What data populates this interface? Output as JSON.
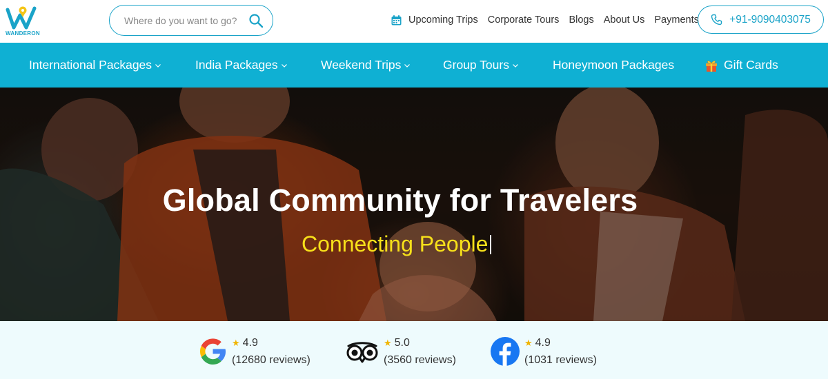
{
  "brand": {
    "name": "WANDERON",
    "accent": "#0fb0d3"
  },
  "search": {
    "placeholder": "Where do you want to go?",
    "icon": "search-icon"
  },
  "top_links": [
    {
      "label": "Upcoming Trips",
      "icon": "calendar-icon"
    },
    {
      "label": "Corporate Tours"
    },
    {
      "label": "Blogs"
    },
    {
      "label": "About Us"
    },
    {
      "label": "Payments"
    }
  ],
  "phone": {
    "label": "+91-9090403075",
    "icon": "phone-icon"
  },
  "nav": [
    {
      "label": "International Packages",
      "dropdown": true
    },
    {
      "label": "India Packages",
      "dropdown": true
    },
    {
      "label": "Weekend Trips",
      "dropdown": true
    },
    {
      "label": "Group Tours",
      "dropdown": true
    },
    {
      "label": "Honeymoon Packages",
      "dropdown": false
    },
    {
      "label": "Gift Cards",
      "icon": "gift-icon"
    }
  ],
  "hero": {
    "title": "Global Community for Travelers",
    "subtitle": "Connecting People",
    "subtitle_color": "#f7e01a"
  },
  "reviews": [
    {
      "platform_icon": "google-icon",
      "rating": "4.9",
      "count": "(12680 reviews)"
    },
    {
      "platform_icon": "tripadvisor-icon",
      "rating": "5.0",
      "count": "(3560 reviews)"
    },
    {
      "platform_icon": "facebook-icon",
      "rating": "4.9",
      "count": "(1031 reviews)"
    }
  ]
}
